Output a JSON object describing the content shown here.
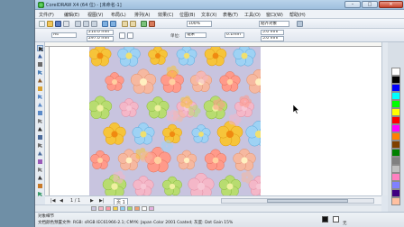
{
  "window": {
    "title": "CorelDRAW X4 (64 位) - [未命名-1]"
  },
  "menu": [
    "文件(F)",
    "编辑(E)",
    "视图(V)",
    "布局(L)",
    "排列(A)",
    "效果(C)",
    "位图(B)",
    "文本(X)",
    "表格(T)",
    "工具(O)",
    "窗口(W)",
    "帮助(H)"
  ],
  "toolbar": {
    "zoom": "100%",
    "snap_label": "贴齐对象"
  },
  "propbar": {
    "paper_size": "A4",
    "width": "210.0 mm",
    "height": "297.0 mm",
    "units_label": "单位:",
    "units": "毫米",
    "nudge": "0.1mm",
    "dup_x": "5.0 mm",
    "dup_y": "5.0 mm"
  },
  "pagetabs": {
    "counter": "1 / 1",
    "tab": "页 1"
  },
  "status": {
    "line1": "对象细节",
    "line2": "文档颜色预置文件: RGB: sRGB IEC61966-2.1; CMYK: Japan Color 2001 Coated; 灰度: Dot Gain 15%",
    "extra": "无"
  },
  "colors": {
    "pattern_background": "#c8c4df",
    "palette": [
      "#ffffff",
      "#000000",
      "#0000ff",
      "#00ffff",
      "#00ff00",
      "#ffff00",
      "#ff0000",
      "#ff00ff",
      "#ff8000",
      "#804000",
      "#008000",
      "#808080",
      "#c0c0c0",
      "#ff80c0",
      "#8080ff",
      "#400080",
      "#ffc0a0"
    ],
    "document_palette": [
      "#c8c4df",
      "#f4b7c8",
      "#ff9aa6",
      "#f5d34a",
      "#8fd0f2",
      "#a6d86b",
      "#f0a070",
      "#ffffff",
      "#e6b0e0"
    ]
  }
}
